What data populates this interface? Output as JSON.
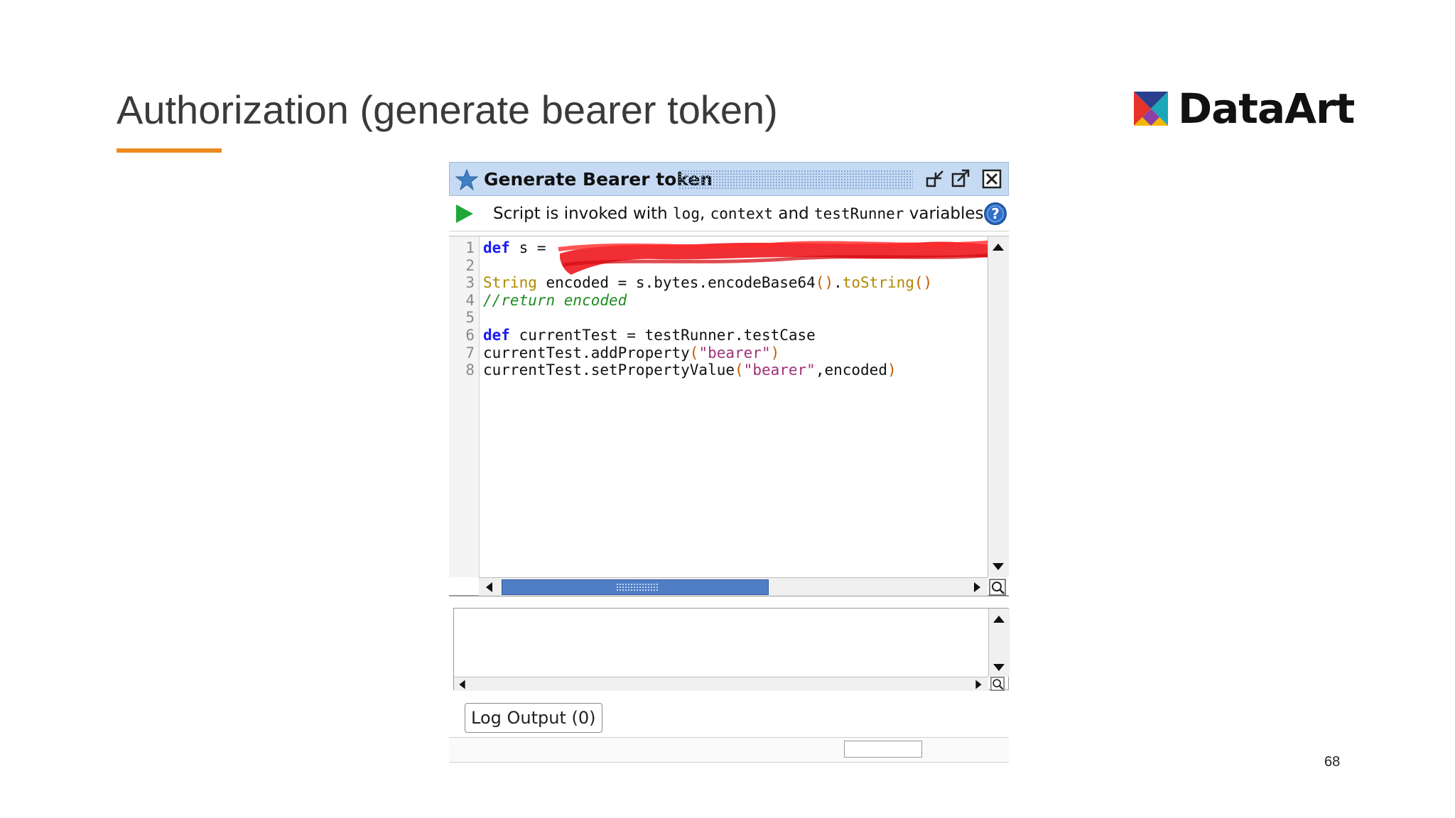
{
  "slide": {
    "title": "Authorization (generate bearer token)",
    "page_number": "68",
    "accent_color": "#ee8a1f"
  },
  "logo": {
    "text": "DataArt",
    "icon": "dataart-logo-icon"
  },
  "window": {
    "title": "Generate Bearer token",
    "title_icon": "star-icon",
    "buttons": [
      "minimize-icon",
      "detach-icon",
      "close-icon"
    ],
    "info": {
      "prefix": "Script is invoked with ",
      "var1": "log",
      "sep1": ", ",
      "var2": "context",
      "sep2": " and ",
      "var3": "testRunner",
      "suffix": " variables"
    },
    "script": {
      "line_numbers": [
        "1",
        "2",
        "3",
        "4",
        "5",
        "6",
        "7",
        "8"
      ],
      "line1": {
        "kw": "def",
        "rest": " s = "
      },
      "line3": {
        "type": "String",
        "mid": " encoded = s.bytes.encodeBase64",
        "p1": "()",
        "dot": ".",
        "call": "toString",
        "p2": "()"
      },
      "line4": {
        "comment": "//return encoded"
      },
      "line6": {
        "kw": "def",
        "rest": " currentTest = testRunner.testCase"
      },
      "line7": {
        "a": "currentTest.addProperty",
        "p1": "(",
        "s": "\"bearer\"",
        "p2": ")"
      },
      "line8": {
        "a": "currentTest.setPropertyValue",
        "p1": "(",
        "s": "\"bearer\"",
        "b": ",encoded",
        "p2": ")"
      }
    },
    "log_tab": "Log Output (0)"
  }
}
